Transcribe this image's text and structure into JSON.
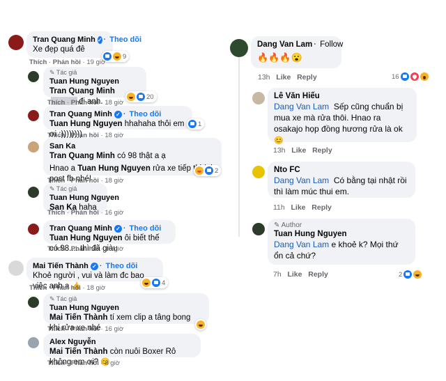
{
  "left": {
    "c1": {
      "author": "Tran Quang Minh",
      "follow": "Theo dõi",
      "text": "Xe đẹp quá đê",
      "like": "Thích",
      "reply": "Phản hồi",
      "time": "19 giờ",
      "reacts": "9"
    },
    "c2": {
      "badge": "Tác giả",
      "author": "Tuan Hung Nguyen",
      "mention": "Tran Quang Minh",
      "text": "đi anh.",
      "like": "Thích",
      "reply": "Phản hồi",
      "time": "18 giờ",
      "reacts": "20"
    },
    "c3": {
      "author": "Tran Quang Minh",
      "follow": "Theo dõi",
      "mention": "Tuan Hung Nguyen",
      "text": "hhahaha thôi em ơi :))))))))",
      "like": "Thích",
      "reply": "Phản hồi",
      "time": "18 giờ",
      "reacts": "1"
    },
    "c4": {
      "author": "San Ka",
      "line1_mention": "Tran Quang Minh",
      "line1": "có 98 thật a ạ",
      "line2_pre": "Hnao a",
      "line2_mention": "Tuan Hung Nguyen",
      "line2": "rửa xe tiếp thì lại post fb nhé!",
      "like": "Thích",
      "reply": "Phản hồi",
      "time": "18 giờ",
      "reacts": "2"
    },
    "c5": {
      "badge": "Tác giả",
      "author": "Tuan Hung Nguyen",
      "mention": "San Ka",
      "text": "haha",
      "like": "Thích",
      "reply": "Phản hồi",
      "time": "16 giờ"
    },
    "c6": {
      "author": "Tran Quang Minh",
      "follow": "Theo dõi",
      "mention": "Tuan Hung Nguyen",
      "text": "ôi biết thế có 98.... thì đã giàu",
      "like": "Thích",
      "reply": "Phản hồi",
      "time": "16 giờ"
    },
    "c7": {
      "author": "Mai Tiến Thành",
      "follow": "Theo dõi",
      "text": "Khoẻ người , vui và làm đc bao việc anh a",
      "like": "Thích",
      "reply": "Phản hồi",
      "time": "18 giờ",
      "reacts": "4"
    },
    "c8": {
      "badge": "Tác giả",
      "author": "Tuan Hung Nguyen",
      "mention": "Mai Tiến Thành",
      "text": "tí xem clip a tâng bong khi rửa xe nhé",
      "like": "Thích",
      "reply": "Phản hồi",
      "time": "16 giờ"
    },
    "c9": {
      "author": "Alex Nguyễn",
      "mention": "Mai Tiến Thành",
      "text": "còn nuôi Boxer Rô không em ơi?",
      "like": "Thích",
      "reply": "Phản hồi",
      "time": "8 giờ"
    }
  },
  "right": {
    "r1": {
      "author": "Dang Van Lam",
      "follow": "Follow",
      "emojis": "🔥🔥🔥😮",
      "time": "13h",
      "like": "Like",
      "reply": "Reply",
      "reacts": "16"
    },
    "r2": {
      "author": "Lê Văn Hiếu",
      "mention": "Dang Van Lam",
      "text": "Sếp cũng chuẩn bị mua xe mà rửa thôi. Hnao ra osakajo họp đồng hương rửa là ok",
      "time": "13h",
      "like": "Like",
      "reply": "Reply"
    },
    "r3": {
      "author": "Nto FC",
      "mention": "Dang Van Lam",
      "text": "Có bằng tại nhật rồi thì làm múc thui em.",
      "time": "11h",
      "like": "Like",
      "reply": "Reply"
    },
    "r4": {
      "badge": "Author",
      "author": "Tuan Hung Nguyen",
      "mention": "Dang Van Lam",
      "text": "e khoẻ k? Mọi thứ ổn cả chứ?",
      "time": "7h",
      "like": "Like",
      "reply": "Reply",
      "reacts": "2"
    }
  },
  "colors": {
    "accent": "#1877f2",
    "bubble": "#f0f2f5",
    "meta": "#65676b"
  }
}
